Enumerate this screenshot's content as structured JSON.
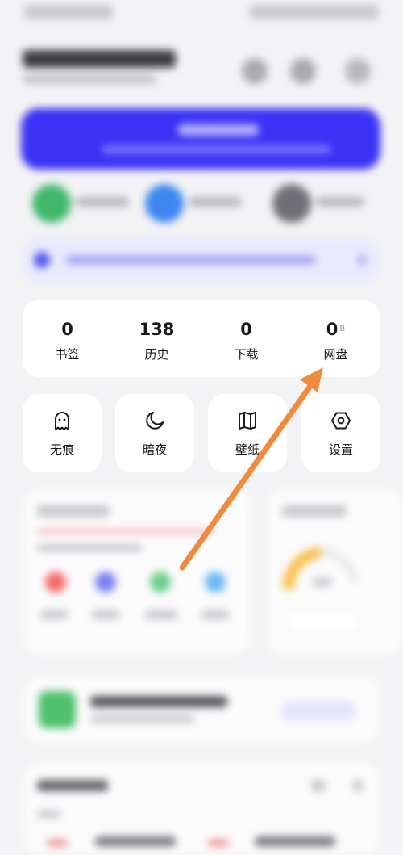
{
  "stats": [
    {
      "value": "0",
      "label": "书签",
      "unit": ""
    },
    {
      "value": "138",
      "label": "历史",
      "unit": ""
    },
    {
      "value": "0",
      "label": "下载",
      "unit": ""
    },
    {
      "value": "0",
      "label": "网盘",
      "unit": "B"
    }
  ],
  "tiles": [
    {
      "label": "无痕",
      "icon": "ghost-icon"
    },
    {
      "label": "暗夜",
      "icon": "moon-icon"
    },
    {
      "label": "壁纸",
      "icon": "book-icon"
    },
    {
      "label": "设置",
      "icon": "hexagon-settings-icon"
    }
  ],
  "colors": {
    "accent_blue": "#3a32f5",
    "annotation_arrow": "#f08a3c",
    "green_circle": "#3fb86b",
    "blue_circle": "#3d86f0",
    "gray_circle": "#6f6f76"
  }
}
